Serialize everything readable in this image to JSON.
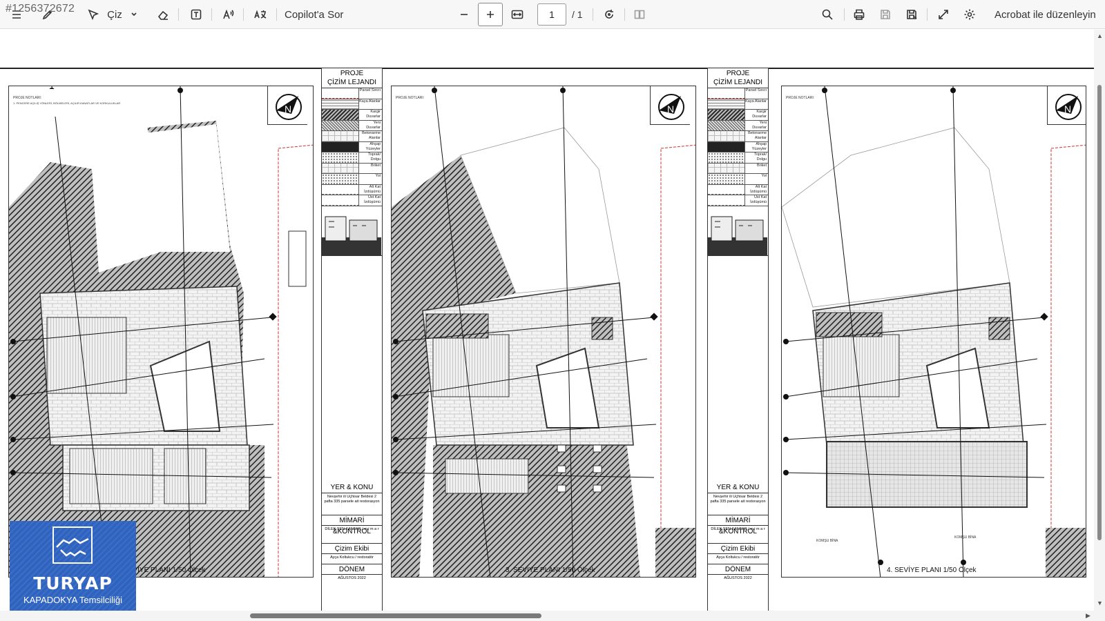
{
  "watermark_id": "#1256372672",
  "toolbar": {
    "draw_label": "Çiz",
    "copilot_label": "Copilot'a Sor",
    "page_current": "1",
    "page_total": "/ 1",
    "edit_label": "Acrobat ile düzenleyin",
    "icons": [
      "contents-icon",
      "highlight-icon",
      "draw-icon",
      "chevron-down-icon",
      "eraser-icon",
      "text-box-icon",
      "read-aloud-icon",
      "translate-icon",
      "zoom-out-icon",
      "zoom-in-icon",
      "fit-width-icon",
      "rotate-icon",
      "page-view-icon",
      "search-icon",
      "print-icon",
      "save-icon",
      "save-as-icon",
      "fullscreen-icon",
      "settings-icon"
    ]
  },
  "document": {
    "legend": {
      "title_line1": "PROJE",
      "title_line2": "ÇİZİM LEJANDI",
      "rows": [
        "Parsel Sınırı",
        "Kaya Alanlar",
        "Kargir Duvarlar",
        "Yeni Duvarlar",
        "Betonarme Alanlar",
        "Ahşap Yüzeyler",
        "Toprak/ Dolgu",
        "Briket",
        "Yol",
        "Alt Kat İzdüşümü",
        "Üst Kat İzdüşümü"
      ],
      "location_title": "YER & KONU",
      "location_text": "Nevşehir ili Uçhisar Beldesi 2 pafta 335 parsele ait restorasyon",
      "control_title": "MİMARİ &KONTROL",
      "control_text": "DİLEK ŞEN KANTAR / m i m a r",
      "team_title": "Çizim Ekibi",
      "team_text": "Ayça Koltukcu / restoratör",
      "period_title": "DÖNEM",
      "period_text": "AĞUSTOS 2022"
    },
    "plans": [
      {
        "caption": "2. SEVİYE PLANI 1/50  Ölçek"
      },
      {
        "caption": "3. SEVİYE PLANI 1/50  Ölçek"
      },
      {
        "caption": "4. SEVİYE PLANI 1/50  Ölçek"
      }
    ],
    "plan_notes_title": "PROJE NOTLARI:",
    "plan_notes_text": "1. PENCERE AÇILIŞ YÖNLERİ, BÖLMELERİ, AÇILIR KANATLAR VE KORKULUKLAR GÖRSEL OLARAK GÖSTERİLMİŞTİR. YAPIM SIRASINDA UYGUN ŞEKİLDE DEĞİŞTİRİLEBİLİR.",
    "neighbour_label": "KOMŞU BİNA"
  },
  "logo": {
    "name": "TURYAP",
    "subtitle": "KAPADOKYA Temsilciliği"
  }
}
